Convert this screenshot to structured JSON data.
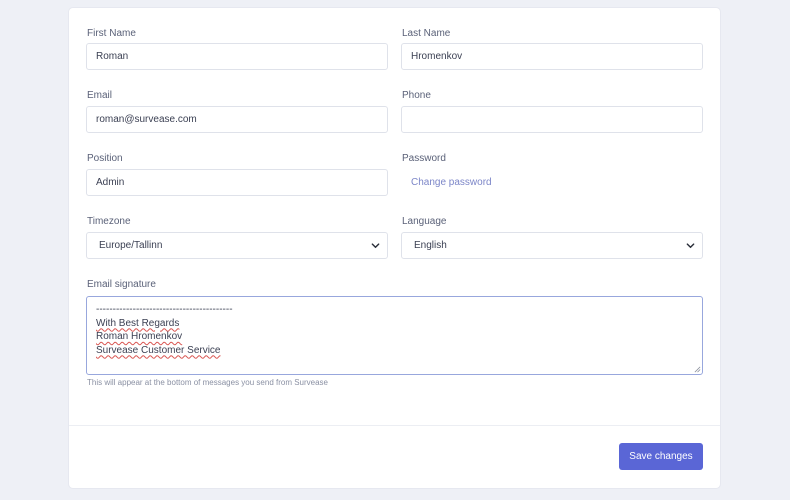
{
  "form": {
    "first_name": {
      "label": "First Name",
      "value": "Roman"
    },
    "last_name": {
      "label": "Last Name",
      "value": "Hromenkov"
    },
    "email": {
      "label": "Email",
      "value": "roman@survease.com"
    },
    "phone": {
      "label": "Phone",
      "value": ""
    },
    "position": {
      "label": "Position",
      "value": "Admin"
    },
    "password": {
      "label": "Password",
      "link": "Change password"
    },
    "timezone": {
      "label": "Timezone",
      "value": "Europe/Tallinn"
    },
    "language": {
      "label": "Language",
      "value": "English"
    },
    "signature": {
      "label": "Email signature",
      "lines": [
        "-----------------------------------------",
        "With Best Regards",
        "Roman Hromenkov",
        "Survease Customer Service"
      ],
      "help": "This will appear at the bottom of messages you send from Survease"
    },
    "save_label": "Save changes"
  },
  "icons": {
    "chevron": "chevron-down-icon",
    "resize": "resize-handle-icon"
  },
  "colors": {
    "accent": "#5a66d6",
    "link": "#7c86c8",
    "focus_border": "#98a7dd",
    "spell_underline": "#d8534f"
  }
}
